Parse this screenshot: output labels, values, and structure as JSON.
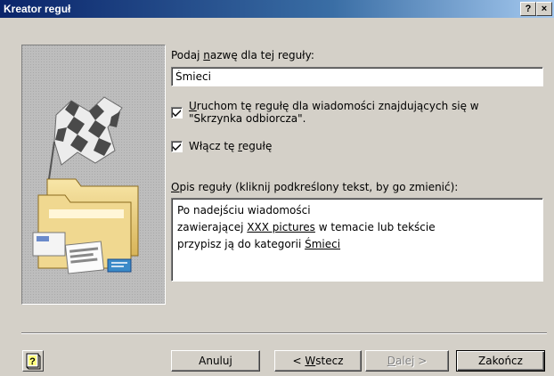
{
  "window": {
    "title": "Kreator reguł",
    "help_button": "?",
    "close_button": "×"
  },
  "form": {
    "name_label_before": "Podaj ",
    "name_label_accel": "n",
    "name_label_after": "azwę dla tej reguły:",
    "name_value": "Śmieci",
    "run_rule": {
      "checked": true,
      "label_accel": "U",
      "label_line1_rest": "ruchom tę regułę dla wiadomości znajdujących się w",
      "label_line2": "\"Skrzynka odbiorcza\"."
    },
    "enable_rule": {
      "checked": true,
      "label_before": "Włącz tę ",
      "label_accel": "r",
      "label_after": "egułę"
    },
    "description_label_accel": "O",
    "description_label_rest": "pis reguły (kliknij podkreślony tekst, by go zmienić):",
    "description": {
      "line1": "Po nadejściu wiadomości",
      "line2_before": "zawierającej ",
      "line2_link": "XXX pictures",
      "line2_after": " w temacie lub tekście",
      "line3_before": "przypisz ją do kategorii ",
      "line3_link": "Śmieci"
    }
  },
  "buttons": {
    "help_icon": "help-icon",
    "cancel": "Anuluj",
    "back_before": "< ",
    "back_accel": "W",
    "back_after": "stecz",
    "next_accel": "D",
    "next_after": "alej >",
    "finish": "Zakończ"
  },
  "colors": {
    "dialog_face": "#d4d0c8",
    "title_gradient_start": "#0a246a",
    "title_gradient_end": "#a6caf0",
    "disabled_text": "#808080"
  }
}
